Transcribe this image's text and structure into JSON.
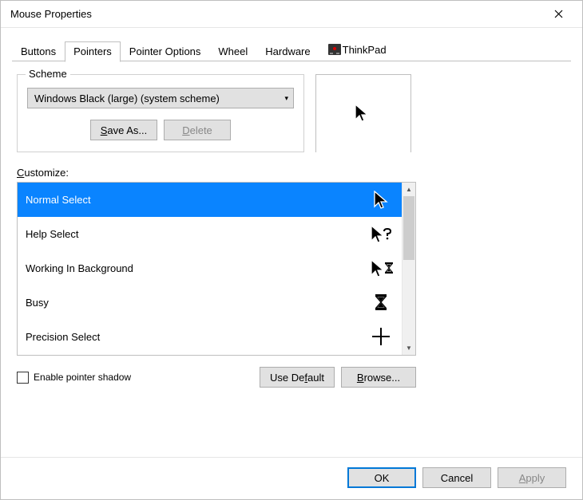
{
  "window": {
    "title": "Mouse Properties"
  },
  "tabs": [
    {
      "label": "Buttons"
    },
    {
      "label": "Pointers"
    },
    {
      "label": "Pointer Options"
    },
    {
      "label": "Wheel"
    },
    {
      "label": "Hardware"
    },
    {
      "label": "ThinkPad"
    }
  ],
  "active_tab": "Pointers",
  "scheme": {
    "legend": "Scheme",
    "selected": "Windows Black (large) (system scheme)",
    "save_as": "Save As...",
    "delete": "Delete"
  },
  "customize": {
    "label": "Customize:",
    "items": [
      {
        "label": "Normal Select",
        "icon": "cursor-arrow",
        "selected": true
      },
      {
        "label": "Help Select",
        "icon": "cursor-help",
        "selected": false
      },
      {
        "label": "Working In Background",
        "icon": "cursor-background",
        "selected": false
      },
      {
        "label": "Busy",
        "icon": "cursor-busy",
        "selected": false
      },
      {
        "label": "Precision Select",
        "icon": "cursor-precision",
        "selected": false
      }
    ]
  },
  "shadow": {
    "label": "Enable pointer shadow",
    "checked": false
  },
  "buttons": {
    "use_default": "Use Default",
    "browse": "Browse...",
    "ok": "OK",
    "cancel": "Cancel",
    "apply": "Apply"
  }
}
